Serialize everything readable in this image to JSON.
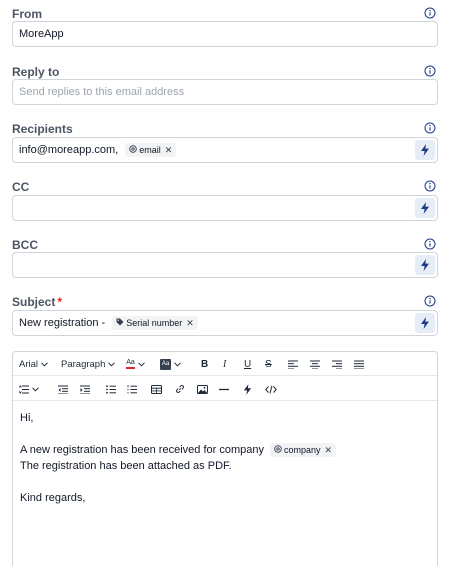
{
  "from": {
    "label": "From",
    "value": "MoreApp"
  },
  "reply_to": {
    "label": "Reply to",
    "placeholder": "Send replies to this email address"
  },
  "recipients": {
    "label": "Recipients",
    "value": "info@moreapp.com,",
    "chip": "email"
  },
  "cc": {
    "label": "CC",
    "value": ""
  },
  "bcc": {
    "label": "BCC",
    "value": ""
  },
  "subject": {
    "label": "Subject",
    "required_mark": "*",
    "value": "New registration -",
    "chip": "Serial number"
  },
  "toolbar": {
    "font": "Arial",
    "block": "Paragraph",
    "font_color_label": "Aa",
    "highlight_label": "Aa",
    "bold": "B",
    "italic": "I",
    "underline": "U",
    "strike": "S"
  },
  "editor": {
    "line1": "Hi,",
    "line2": "A new registration has been received for company",
    "line2_chip": "company",
    "line3": "The registration has been attached as PDF.",
    "line4": "Kind regards,"
  },
  "colors": {
    "bolt_bg": "#e7edf7",
    "icon_blue": "#1e3a8a",
    "required": "#dc2626"
  },
  "icons": [
    "info-icon",
    "bolt-icon",
    "email-at-icon",
    "tag-icon",
    "close-icon",
    "chevron-down-icon",
    "bold-icon",
    "italic-icon",
    "underline-icon",
    "strikethrough-icon",
    "align-left-icon",
    "align-center-icon",
    "align-right-icon",
    "justify-icon",
    "line-height-icon",
    "outdent-icon",
    "indent-icon",
    "bullet-list-icon",
    "numbered-list-icon",
    "table-icon",
    "link-icon",
    "image-icon",
    "horizontal-rule-icon",
    "code-icon"
  ]
}
